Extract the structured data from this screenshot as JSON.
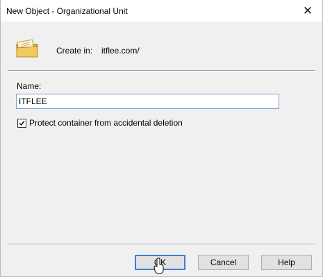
{
  "window": {
    "title": "New Object - Organizational Unit",
    "close_glyph": "✕"
  },
  "header": {
    "create_in_label": "Create in:",
    "create_in_value": "itflee.com/"
  },
  "form": {
    "name_label": "Name:",
    "name_value": "ITFLEE",
    "protect_label": "Protect container from accidental deletion",
    "protect_checked": true
  },
  "buttons": {
    "ok": "OK",
    "cancel": "Cancel",
    "help": "Help"
  },
  "icons": {
    "ou": "organizational-unit-folder-icon",
    "cursor": "mouse-pointer-icon"
  },
  "colors": {
    "accent": "#3c7fd6",
    "folder": "#e9c35a"
  }
}
